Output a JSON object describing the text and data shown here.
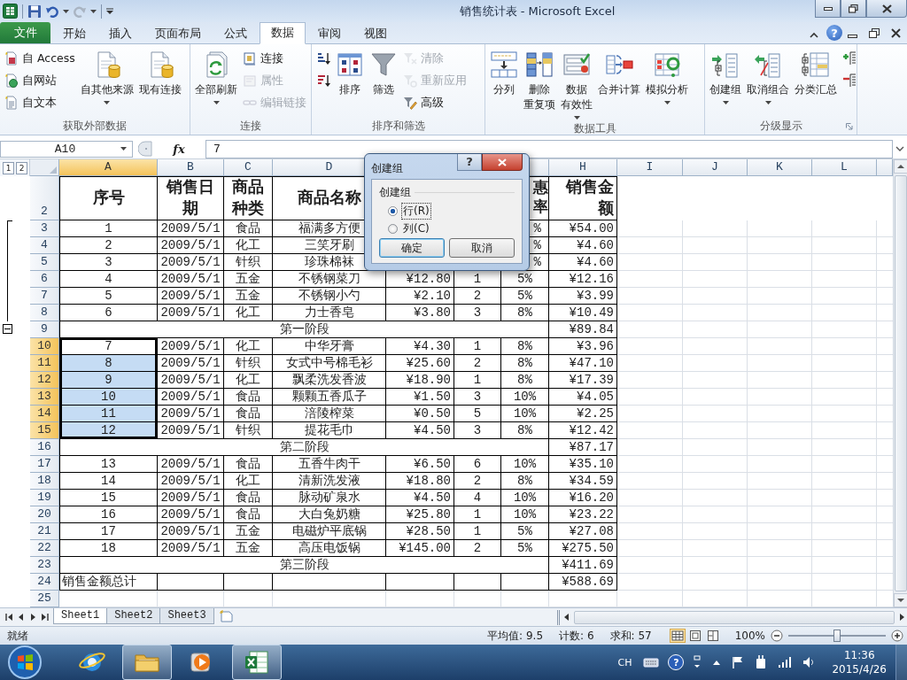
{
  "title": "销售统计表 - Microsoft Excel",
  "file_tab": "文件",
  "tabs": [
    {
      "label": "开始",
      "selected": false
    },
    {
      "label": "插入",
      "selected": false
    },
    {
      "label": "页面布局",
      "selected": false
    },
    {
      "label": "公式",
      "selected": false
    },
    {
      "label": "数据",
      "selected": true
    },
    {
      "label": "审阅",
      "selected": false
    },
    {
      "label": "视图",
      "selected": false
    }
  ],
  "help_glyph": "?",
  "ribbon": [
    {
      "label": "获取外部数据",
      "columns": [
        {
          "kind": "small_stack",
          "items": [
            {
              "label": "自 Access",
              "disabled": false
            },
            {
              "label": "自网站",
              "disabled": false
            },
            {
              "label": "自文本",
              "disabled": false
            }
          ]
        },
        {
          "kind": "large",
          "label": "自其他来源",
          "menu": true
        },
        {
          "kind": "large",
          "label": "现有连接"
        }
      ]
    },
    {
      "label": "连接",
      "columns": [
        {
          "kind": "large",
          "label": "全部刷新",
          "menu": true
        },
        {
          "kind": "small_stack",
          "items": [
            {
              "label": "连接",
              "disabled": false
            },
            {
              "label": "属性",
              "disabled": true
            },
            {
              "label": "编辑链接",
              "disabled": true
            }
          ]
        }
      ]
    },
    {
      "label": "排序和筛选",
      "columns": [
        {
          "kind": "small_stack",
          "items": [
            {
              "disabled": false
            },
            {
              "disabled": false
            }
          ]
        },
        {
          "kind": "large",
          "label": "排序"
        },
        {
          "kind": "large",
          "label": "筛选"
        },
        {
          "kind": "small_stack",
          "items": [
            {
              "label": "清除",
              "disabled": true
            },
            {
              "label": "重新应用",
              "disabled": true
            },
            {
              "label": "高级",
              "disabled": false
            }
          ]
        }
      ]
    },
    {
      "label": "数据工具",
      "columns": [
        {
          "kind": "large",
          "label": "分列"
        },
        {
          "kind": "large",
          "lines": [
            "删除",
            "重复项"
          ]
        },
        {
          "kind": "large",
          "lines": [
            "数据",
            "有效性"
          ],
          "menu": true
        },
        {
          "kind": "large",
          "label": "合并计算"
        },
        {
          "kind": "large",
          "label": "模拟分析",
          "menu": true
        }
      ]
    },
    {
      "label": "分级显示",
      "launcher": true,
      "columns": [
        {
          "kind": "large",
          "label": "创建组",
          "menu": true
        },
        {
          "kind": "large",
          "label": "取消组合",
          "menu": true
        },
        {
          "kind": "large",
          "label": "分类汇总"
        },
        {
          "kind": "small_stack",
          "items": [
            {
              "disabled": false
            },
            {
              "disabled": false
            }
          ]
        }
      ]
    }
  ],
  "formula_bar": {
    "name_box": "A10",
    "function_label": "fx",
    "value": "7"
  },
  "outline_levels": [
    "1",
    "2"
  ],
  "columns": [
    {
      "letter": "A",
      "selected": true
    },
    {
      "letter": "B",
      "selected": false
    },
    {
      "letter": "C",
      "selected": false
    },
    {
      "letter": "D",
      "selected": false
    },
    {},
    {},
    {
      "selected": false
    },
    {
      "letter": "H",
      "selected": false
    },
    {
      "letter": "I",
      "selected": false
    },
    {
      "letter": "J",
      "selected": false
    },
    {
      "letter": "K",
      "selected": false
    },
    {
      "letter": "L",
      "selected": false
    }
  ],
  "rows": [
    {
      "number": "2",
      "kind": "header",
      "covered": true,
      "selected": false,
      "cells": {
        "A": "序号",
        "B": "销售日期",
        "C": "商品种类",
        "D": "商品名称",
        "G": "惠率",
        "H": "销售金额"
      }
    },
    {
      "number": "3",
      "kind": "item",
      "covered": true,
      "in_group": true,
      "selected": false,
      "cells": {
        "A": "1",
        "B": "2009/5/1",
        "C": "食品",
        "D": "福满多方便",
        "G": "%",
        "H": "¥54.00"
      }
    },
    {
      "number": "4",
      "kind": "item",
      "covered": true,
      "in_group": true,
      "selected": false,
      "cells": {
        "A": "2",
        "B": "2009/5/1",
        "C": "化工",
        "D": "三笑牙刷",
        "G": "%",
        "H": "¥4.60"
      }
    },
    {
      "number": "5",
      "kind": "item",
      "covered": true,
      "in_group": true,
      "selected": false,
      "cells": {
        "A": "3",
        "B": "2009/5/1",
        "C": "针织",
        "D": "珍珠棉袜",
        "G": "%",
        "H": "¥4.60"
      }
    },
    {
      "number": "6",
      "kind": "item",
      "in_group": true,
      "selected": false,
      "cells": {
        "A": "4",
        "B": "2009/5/1",
        "C": "五金",
        "D": "不锈钢菜刀",
        "E": "¥12.80",
        "F": "1",
        "G": "5%",
        "H": "¥12.16"
      }
    },
    {
      "number": "7",
      "kind": "item",
      "in_group": true,
      "selected": false,
      "cells": {
        "A": "5",
        "B": "2009/5/1",
        "C": "五金",
        "D": "不锈钢小勺",
        "E": "¥2.10",
        "F": "2",
        "G": "5%",
        "H": "¥3.99"
      }
    },
    {
      "number": "8",
      "kind": "item",
      "in_group": true,
      "selected": false,
      "cells": {
        "A": "6",
        "B": "2009/5/1",
        "C": "化工",
        "D": "力士香皂",
        "E": "¥3.80",
        "F": "3",
        "G": "8%",
        "H": "¥10.49"
      }
    },
    {
      "number": "9",
      "kind": "subtotal",
      "group_toggle": true,
      "selected": false,
      "label": "第一阶段",
      "amount": "¥89.84"
    },
    {
      "number": "10",
      "kind": "item",
      "selected": true,
      "active": true,
      "cells": {
        "A": "7",
        "B": "2009/5/1",
        "C": "化工",
        "D": "中华牙膏",
        "E": "¥4.30",
        "F": "1",
        "G": "8%",
        "H": "¥3.96"
      }
    },
    {
      "number": "11",
      "kind": "item",
      "selected": true,
      "cells": {
        "A": "8",
        "B": "2009/5/1",
        "C": "针织",
        "D": "女式中号棉毛衫",
        "E": "¥25.60",
        "F": "2",
        "G": "8%",
        "H": "¥47.10"
      }
    },
    {
      "number": "12",
      "kind": "item",
      "selected": true,
      "cells": {
        "A": "9",
        "B": "2009/5/1",
        "C": "化工",
        "D": "飘柔洗发香波",
        "E": "¥18.90",
        "F": "1",
        "G": "8%",
        "H": "¥17.39"
      }
    },
    {
      "number": "13",
      "kind": "item",
      "selected": true,
      "cells": {
        "A": "10",
        "B": "2009/5/1",
        "C": "食品",
        "D": "颗颗五香瓜子",
        "E": "¥1.50",
        "F": "3",
        "G": "10%",
        "H": "¥4.05"
      }
    },
    {
      "number": "14",
      "kind": "item",
      "selected": true,
      "cells": {
        "A": "11",
        "B": "2009/5/1",
        "C": "食品",
        "D": "涪陵榨菜",
        "E": "¥0.50",
        "F": "5",
        "G": "10%",
        "H": "¥2.25"
      }
    },
    {
      "number": "15",
      "kind": "item",
      "selected": true,
      "cells": {
        "A": "12",
        "B": "2009/5/1",
        "C": "针织",
        "D": "提花毛巾",
        "E": "¥4.50",
        "F": "3",
        "G": "8%",
        "H": "¥12.42"
      }
    },
    {
      "number": "16",
      "kind": "subtotal",
      "selected": false,
      "label": "第二阶段",
      "amount": "¥87.17"
    },
    {
      "number": "17",
      "kind": "item",
      "selected": false,
      "cells": {
        "A": "13",
        "B": "2009/5/1",
        "C": "食品",
        "D": "五香牛肉干",
        "E": "¥6.50",
        "F": "6",
        "G": "10%",
        "H": "¥35.10"
      }
    },
    {
      "number": "18",
      "kind": "item",
      "selected": false,
      "cells": {
        "A": "14",
        "B": "2009/5/1",
        "C": "化工",
        "D": "清新洗发液",
        "E": "¥18.80",
        "F": "2",
        "G": "8%",
        "H": "¥34.59"
      }
    },
    {
      "number": "19",
      "kind": "item",
      "selected": false,
      "cells": {
        "A": "15",
        "B": "2009/5/1",
        "C": "食品",
        "D": "脉动矿泉水",
        "E": "¥4.50",
        "F": "4",
        "G": "10%",
        "H": "¥16.20"
      }
    },
    {
      "number": "20",
      "kind": "item",
      "selected": false,
      "cells": {
        "A": "16",
        "B": "2009/5/1",
        "C": "食品",
        "D": "大白兔奶糖",
        "E": "¥25.80",
        "F": "1",
        "G": "10%",
        "H": "¥23.22"
      }
    },
    {
      "number": "21",
      "kind": "item",
      "selected": false,
      "cells": {
        "A": "17",
        "B": "2009/5/1",
        "C": "五金",
        "D": "电磁炉平底锅",
        "E": "¥28.50",
        "F": "1",
        "G": "5%",
        "H": "¥27.08"
      }
    },
    {
      "number": "22",
      "kind": "item",
      "selected": false,
      "cells": {
        "A": "18",
        "B": "2009/5/1",
        "C": "五金",
        "D": "高压电饭锅",
        "E": "¥145.00",
        "F": "2",
        "G": "5%",
        "H": "¥275.50"
      }
    },
    {
      "number": "23",
      "kind": "subtotal",
      "selected": false,
      "label": "第三阶段",
      "amount": "¥411.69"
    },
    {
      "number": "24",
      "kind": "total",
      "selected": false,
      "label": "销售金额总计",
      "amount": "¥588.69"
    },
    {
      "number": "25",
      "kind": "blank",
      "selected": false
    }
  ],
  "dialog": {
    "title": "创建组",
    "help_glyph": "?",
    "group_label": "创建组",
    "options": [
      {
        "label": "行(R)",
        "selected": true,
        "focused": true
      },
      {
        "label": "列(C)",
        "selected": false,
        "focused": false
      }
    ],
    "buttons": [
      {
        "label": "确定",
        "default": true
      },
      {
        "label": "取消",
        "default": false
      }
    ]
  },
  "sheet_tabs": [
    {
      "label": "Sheet1",
      "selected": true
    },
    {
      "label": "Sheet2",
      "selected": false
    },
    {
      "label": "Sheet3",
      "selected": false
    }
  ],
  "status_bar": {
    "ready": "就绪",
    "average": "平均值: 9.5",
    "count": "计数: 6",
    "sum": "求和: 57",
    "views": [
      {
        "selected": true
      },
      {
        "selected": false
      },
      {
        "selected": false
      }
    ],
    "zoom": "100%",
    "zoom_slider": {
      "level": 0.5
    }
  },
  "taskbar": {
    "apps": [
      {
        "running": false
      },
      {
        "running": true
      },
      {
        "running": false
      },
      {
        "running": true
      }
    ],
    "language": "CH",
    "help_glyph": "?",
    "time": "11:36",
    "date": "2015/4/26"
  }
}
